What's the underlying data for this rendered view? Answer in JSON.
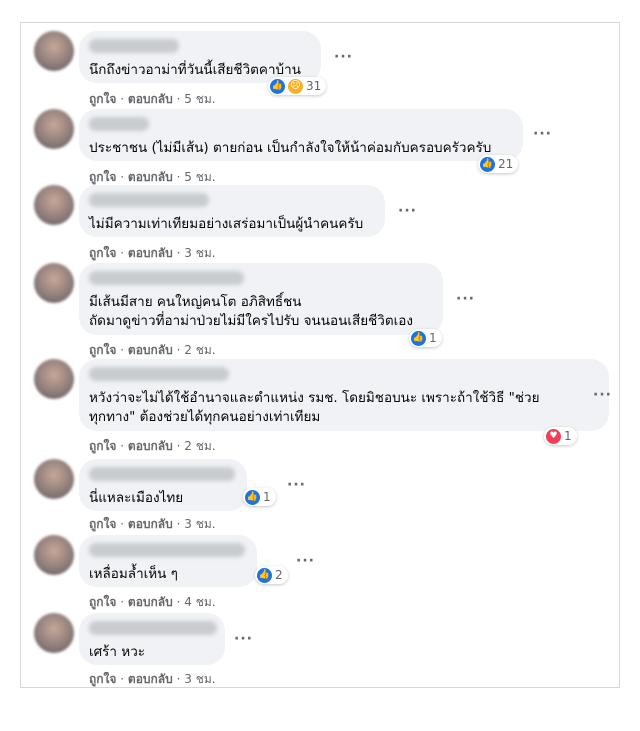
{
  "comments": [
    {
      "text": "นึกถึงข่าวอาม่าที่วันนี้เสียชีวิตคาบ้าน",
      "like_label": "ถูกใจ",
      "reply_label": "ตอบกลับ",
      "time": "5 ชม.",
      "reactions": [
        "like-icon",
        "sad-icon"
      ],
      "reaction_count": "31"
    },
    {
      "text": "ประชาชน (ไม่มีเส้น) ตายก่อน เป็นกำลังใจให้น้าค่อมกับครอบครัวครับ",
      "like_label": "ถูกใจ",
      "reply_label": "ตอบกลับ",
      "time": "5 ชม.",
      "reactions": [
        "like-icon"
      ],
      "reaction_count": "21"
    },
    {
      "text": "ไม่มีความเท่าเทียมอย่างเสร่อมาเป็นผู้นำคนครับ",
      "like_label": "ถูกใจ",
      "reply_label": "ตอบกลับ",
      "time": "3 ชม.",
      "reactions": [],
      "reaction_count": ""
    },
    {
      "text": "มีเส้นมีสาย คนใหญ่คนโต อภิสิทธิ์ชน\nถัดมาดูข่าวที่อาม่าป่วยไม่มีใครไปรับ จนนอนเสียชีวิตเอง",
      "like_label": "ถูกใจ",
      "reply_label": "ตอบกลับ",
      "time": "2 ชม.",
      "reactions": [
        "like-icon"
      ],
      "reaction_count": "1"
    },
    {
      "text": "หวังว่าจะไม่ได้ใช้อำนาจและตำแหน่ง รมช. โดยมิชอบนะ เพราะถ้าใช้วิธี \"ช่วย\nทุกทาง\" ต้องช่วยได้ทุกคนอย่างเท่าเทียม",
      "like_label": "ถูกใจ",
      "reply_label": "ตอบกลับ",
      "time": "2 ชม.",
      "reactions": [
        "love-icon"
      ],
      "reaction_count": "1"
    },
    {
      "text": "นี่แหละเมืองไทย",
      "like_label": "ถูกใจ",
      "reply_label": "ตอบกลับ",
      "time": "3 ชม.",
      "reactions": [
        "like-icon"
      ],
      "reaction_count": "1"
    },
    {
      "text": "เหลื่อมล้ำเห็น ๆ",
      "like_label": "ถูกใจ",
      "reply_label": "ตอบกลับ",
      "time": "4 ชม.",
      "reactions": [
        "like-icon"
      ],
      "reaction_count": "2"
    },
    {
      "text": "เศร้า หวะ",
      "like_label": "ถูกใจ",
      "reply_label": "ตอบกลับ",
      "time": "3 ชม.",
      "reactions": [],
      "reaction_count": ""
    }
  ],
  "more_options_glyph": "···",
  "meta_separator": "·",
  "colors": {
    "like": "#1b74e4",
    "love": "#f33e58",
    "haha": "#f7b125",
    "bubble": "#f0f2f5",
    "meta": "#65676b"
  }
}
